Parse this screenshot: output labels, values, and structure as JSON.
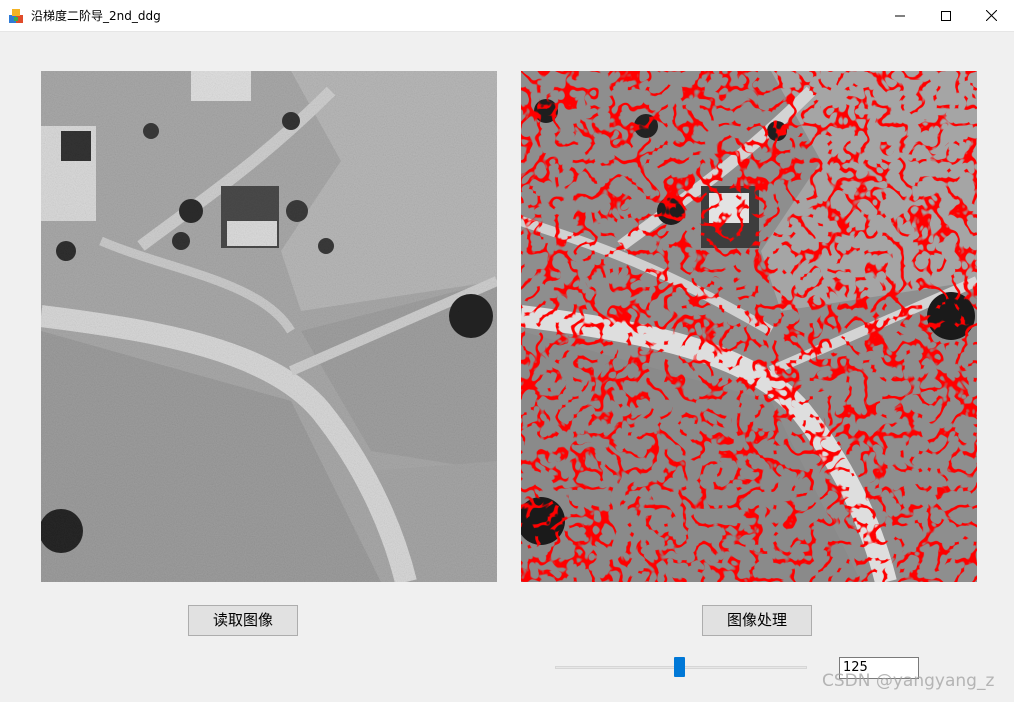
{
  "window": {
    "title": "沿梯度二阶导_2nd_ddg",
    "app_icon": "colored-blocks-icon",
    "controls": [
      "minimize-icon",
      "maximize-icon",
      "close-icon"
    ]
  },
  "images": {
    "original": {
      "name": "original-aerial-image"
    },
    "processed": {
      "name": "processed-edge-image",
      "edge_color": "#ff0000"
    }
  },
  "buttons": {
    "read_image": "读取图像",
    "process_image": "图像处理"
  },
  "threshold": {
    "value": 125,
    "min": 0,
    "max": 255,
    "display": "125"
  },
  "watermark": "CSDN @yangyang_z",
  "colors": {
    "accent": "#0078d7",
    "background": "#f0f0f0"
  }
}
